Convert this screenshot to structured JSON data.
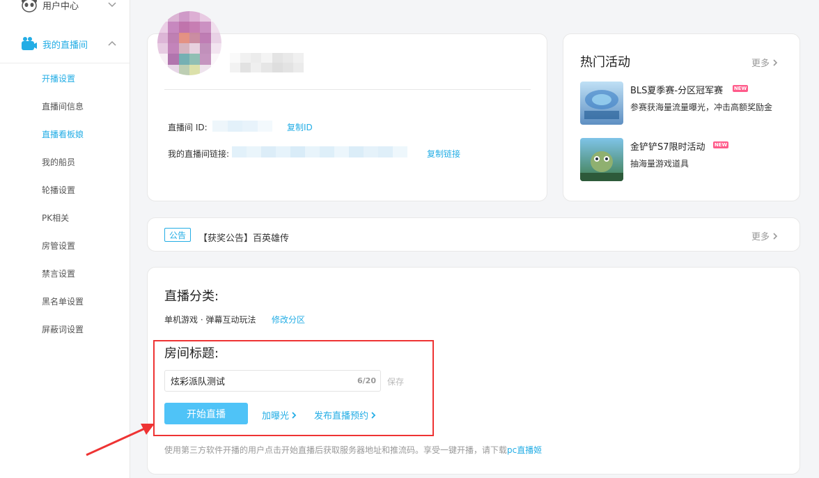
{
  "sidebar": {
    "groups": [
      {
        "label": "用户中心",
        "icon": "panda-icon",
        "expanded": false
      },
      {
        "label": "我的直播间",
        "icon": "tv-icon",
        "expanded": true
      }
    ],
    "items": [
      {
        "label": "开播设置",
        "active": true
      },
      {
        "label": "直播间信息",
        "active": false
      },
      {
        "label": "直播看板娘",
        "active": true
      },
      {
        "label": "我的船员",
        "active": false
      },
      {
        "label": "轮播设置",
        "active": false
      },
      {
        "label": "PK相关",
        "active": false
      },
      {
        "label": "房管设置",
        "active": false
      },
      {
        "label": "禁言设置",
        "active": false
      },
      {
        "label": "黑名单设置",
        "active": false
      },
      {
        "label": "屏蔽词设置",
        "active": false
      }
    ]
  },
  "profile": {
    "room_id_label": "直播间 ID:",
    "copy_id": "复制ID",
    "room_link_label": "我的直播间链接:",
    "copy_link": "复制链接"
  },
  "hot": {
    "title": "热门活动",
    "more": "更多",
    "badge": "NEW",
    "activities": [
      {
        "title": "BLS夏季赛-分区冠军赛",
        "desc": "参赛获海量流量曝光，冲击高额奖励金",
        "is_new": true
      },
      {
        "title": "金铲铲S7限时活动",
        "desc": "抽海量游戏道具",
        "is_new": true
      }
    ]
  },
  "notice": {
    "tag": "公告",
    "text": "【获奖公告】百英雄传",
    "more": "更多"
  },
  "category": {
    "heading": "直播分类:",
    "value": "单机游戏 · 弹幕互动玩法",
    "edit": "修改分区"
  },
  "room_title": {
    "heading": "房间标题:",
    "value": "炫彩派队测试",
    "counter": "6/20",
    "save": "保存",
    "start": "开始直播",
    "boost": "加曝光",
    "reserve": "发布直播预约"
  },
  "note": {
    "text": "使用第三方软件开播的用户点击开始直播后获取服务器地址和推流码。享受一键开播，请下载",
    "link": "pc直播姬"
  },
  "colors": {
    "accent": "#23ade5",
    "start_button": "#4fc3f7",
    "annotation": "#e33333",
    "new_badge": "#ff5b8a"
  }
}
